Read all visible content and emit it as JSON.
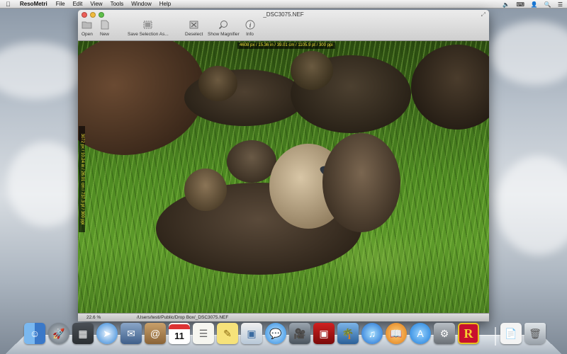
{
  "menubar": {
    "app_name": "ResoMetri",
    "menus": [
      "File",
      "Edit",
      "View",
      "Tools",
      "Window",
      "Help"
    ]
  },
  "window": {
    "title": "_DSC3075.NEF",
    "toolbar": {
      "open": "Open",
      "new": "New",
      "save_selection": "Save Selection As...",
      "deselect": "Deselect",
      "show_magnifier": "Show Magnifier",
      "info": "Info"
    },
    "overlay": {
      "width_readout": "4608 px / 15.36 in / 39.01 cm / 1105.9 pt / 300 ppi",
      "height_readout": "3072 px / 10.24 in / 26.01 cm / 737.3 pt / 300 ppi"
    },
    "status": {
      "zoom": "22.6 %",
      "path": "/Users/testi/Public/Drop Box/_DSC3075.NEF"
    }
  },
  "dock": {
    "apps": [
      "finder",
      "launchpad",
      "mission-control",
      "safari",
      "mail",
      "contacts",
      "calendar",
      "reminders",
      "notes",
      "preview",
      "messages",
      "facetime",
      "photo-booth",
      "iphoto",
      "itunes",
      "ibooks",
      "app-store",
      "system-preferences",
      "resometri",
      "documents",
      "trash"
    ],
    "calendar_day": "11",
    "resometri_letter": "R"
  },
  "colors": {
    "overlay_text": "#f3e23a",
    "accent": "#c8102e"
  }
}
